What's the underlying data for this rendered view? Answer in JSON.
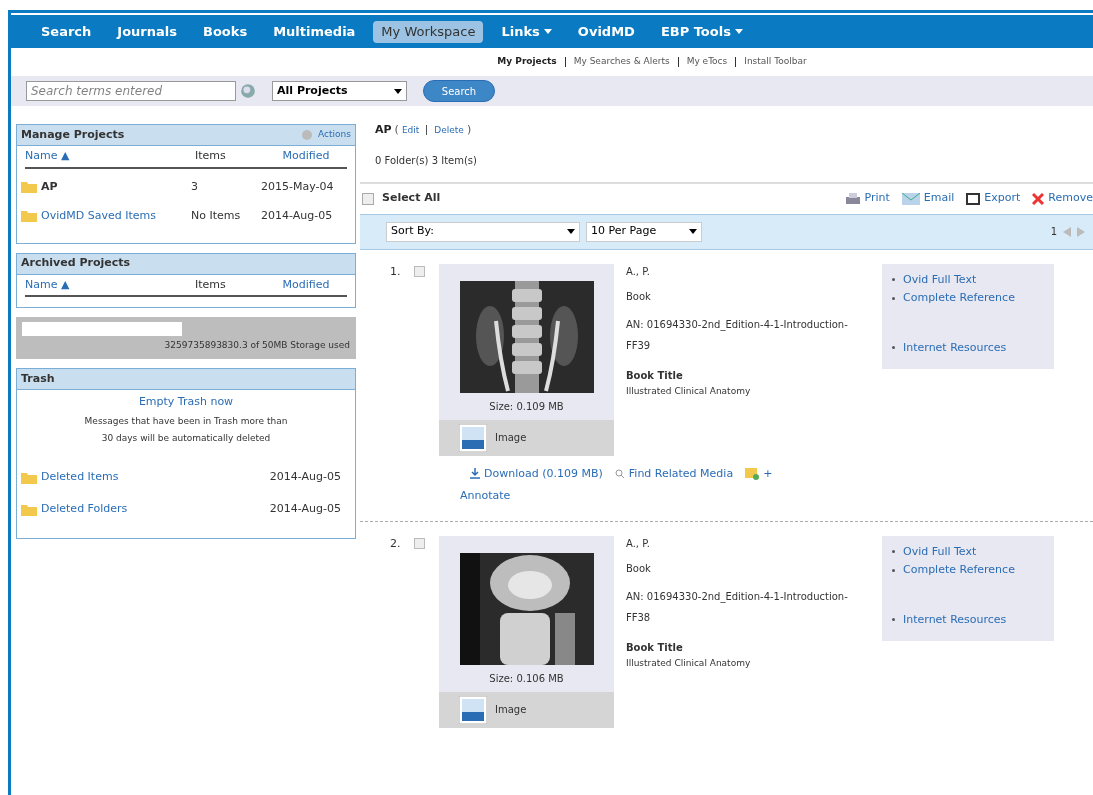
{
  "nav": [
    {
      "label": "Search",
      "selected": false,
      "dropdown": false
    },
    {
      "label": "Journals",
      "selected": false,
      "dropdown": false
    },
    {
      "label": "Books",
      "selected": false,
      "dropdown": false
    },
    {
      "label": "Multimedia",
      "selected": false,
      "dropdown": false
    },
    {
      "label": "My Workspace",
      "selected": true,
      "dropdown": false
    },
    {
      "label": "Links",
      "selected": false,
      "dropdown": true
    },
    {
      "label": "OvidMD",
      "selected": false,
      "dropdown": false
    },
    {
      "label": "EBP Tools",
      "selected": false,
      "dropdown": true
    }
  ],
  "subnav": [
    {
      "label": "My Projects",
      "selected": true
    },
    {
      "label": "My Searches & Alerts",
      "selected": false
    },
    {
      "label": "My eTocs",
      "selected": false
    },
    {
      "label": "Install Toolbar",
      "selected": false
    }
  ],
  "search": {
    "placeholder": "Search terms entered",
    "scope": "All Projects",
    "button": "Search"
  },
  "manage_projects": {
    "title": "Manage Projects",
    "actions": "Actions",
    "columns": [
      "Name ▲",
      "Items",
      "Modified"
    ],
    "rows": [
      {
        "name": "AP",
        "items": "3",
        "modified": "2015-May-04",
        "link": false
      },
      {
        "name": "OvidMD Saved Items",
        "items": "No Items",
        "modified": "2014-Aug-05",
        "link": true
      }
    ]
  },
  "archived_projects": {
    "title": "Archived Projects",
    "columns": [
      "Name ▲",
      "Items",
      "Modified"
    ]
  },
  "storage": {
    "text": "3259735893830.3 of 50MB Storage used"
  },
  "trash": {
    "title": "Trash",
    "empty": "Empty Trash now",
    "note": [
      "Messages that have been in Trash more than",
      "30 days will be automatically deleted"
    ],
    "rows": [
      {
        "name": "Deleted Items",
        "modified": "2014-Aug-05"
      },
      {
        "name": "Deleted Folders",
        "modified": "2014-Aug-05"
      }
    ]
  },
  "project": {
    "name": "AP",
    "edit": "Edit",
    "delete": "Delete",
    "open": "(",
    "close": ")",
    "counts": "0 Folder(s) 3 Item(s)"
  },
  "select_all": {
    "label": "Select All",
    "checked": false
  },
  "toolbar": [
    "Print",
    "Email",
    "Export",
    "Remove"
  ],
  "sort": {
    "sort_by": "Sort By:",
    "per_page": "10 Per Page",
    "page": "1"
  },
  "records": [
    {
      "number": "1.",
      "checked": false,
      "size": "Size: 0.109 MB",
      "type": "Image",
      "author": "A., P.",
      "kind": "Book",
      "an": "AN: 01694330-2nd_Edition-4-1-Introduction-FF39",
      "title_label": "Book Title",
      "title": "Illustrated Clinical Anatomy",
      "links": [
        "Ovid Full Text",
        "Complete Reference",
        "Internet Resources"
      ],
      "actions": {
        "download": "Download (0.109 MB)",
        "related": "Find Related Media",
        "plus": "+",
        "annotate": "Annotate"
      }
    },
    {
      "number": "2.",
      "checked": false,
      "size": "Size: 0.106 MB",
      "type": "Image",
      "author": "A., P.",
      "kind": "Book",
      "an": "AN: 01694330-2nd_Edition-4-1-Introduction-FF38",
      "title_label": "Book Title",
      "title": "Illustrated Clinical Anatomy",
      "links": [
        "Ovid Full Text",
        "Complete Reference",
        "Internet Resources"
      ]
    }
  ]
}
